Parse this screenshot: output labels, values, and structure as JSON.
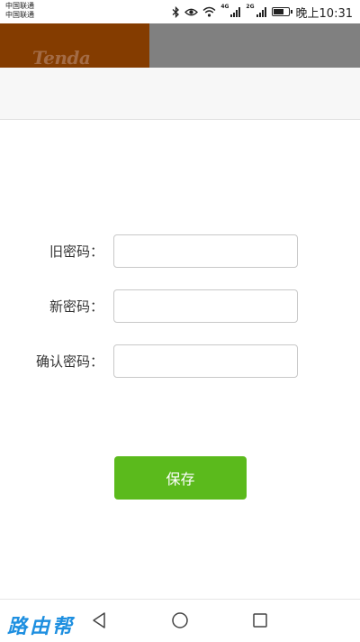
{
  "status_bar": {
    "carrier_1": "中国联通",
    "carrier_2": "中国联通",
    "network_1": "4G",
    "network_2": "2G",
    "battery_level": 0.75,
    "time": "晚上10:31"
  },
  "header": {
    "logo_text": "Tenda",
    "logo_bg_color": "#843c00",
    "bar_color": "#808080"
  },
  "form": {
    "old_password": {
      "label": "旧密码：",
      "value": ""
    },
    "new_password": {
      "label": "新密码：",
      "value": ""
    },
    "confirm_password": {
      "label": "确认密码：",
      "value": ""
    },
    "save_label": "保存",
    "save_color": "#5bba1c"
  },
  "nav_bar": {
    "watermark": "路由帮",
    "icons": [
      "back-triangle-icon",
      "home-circle-icon",
      "recent-square-icon"
    ]
  }
}
